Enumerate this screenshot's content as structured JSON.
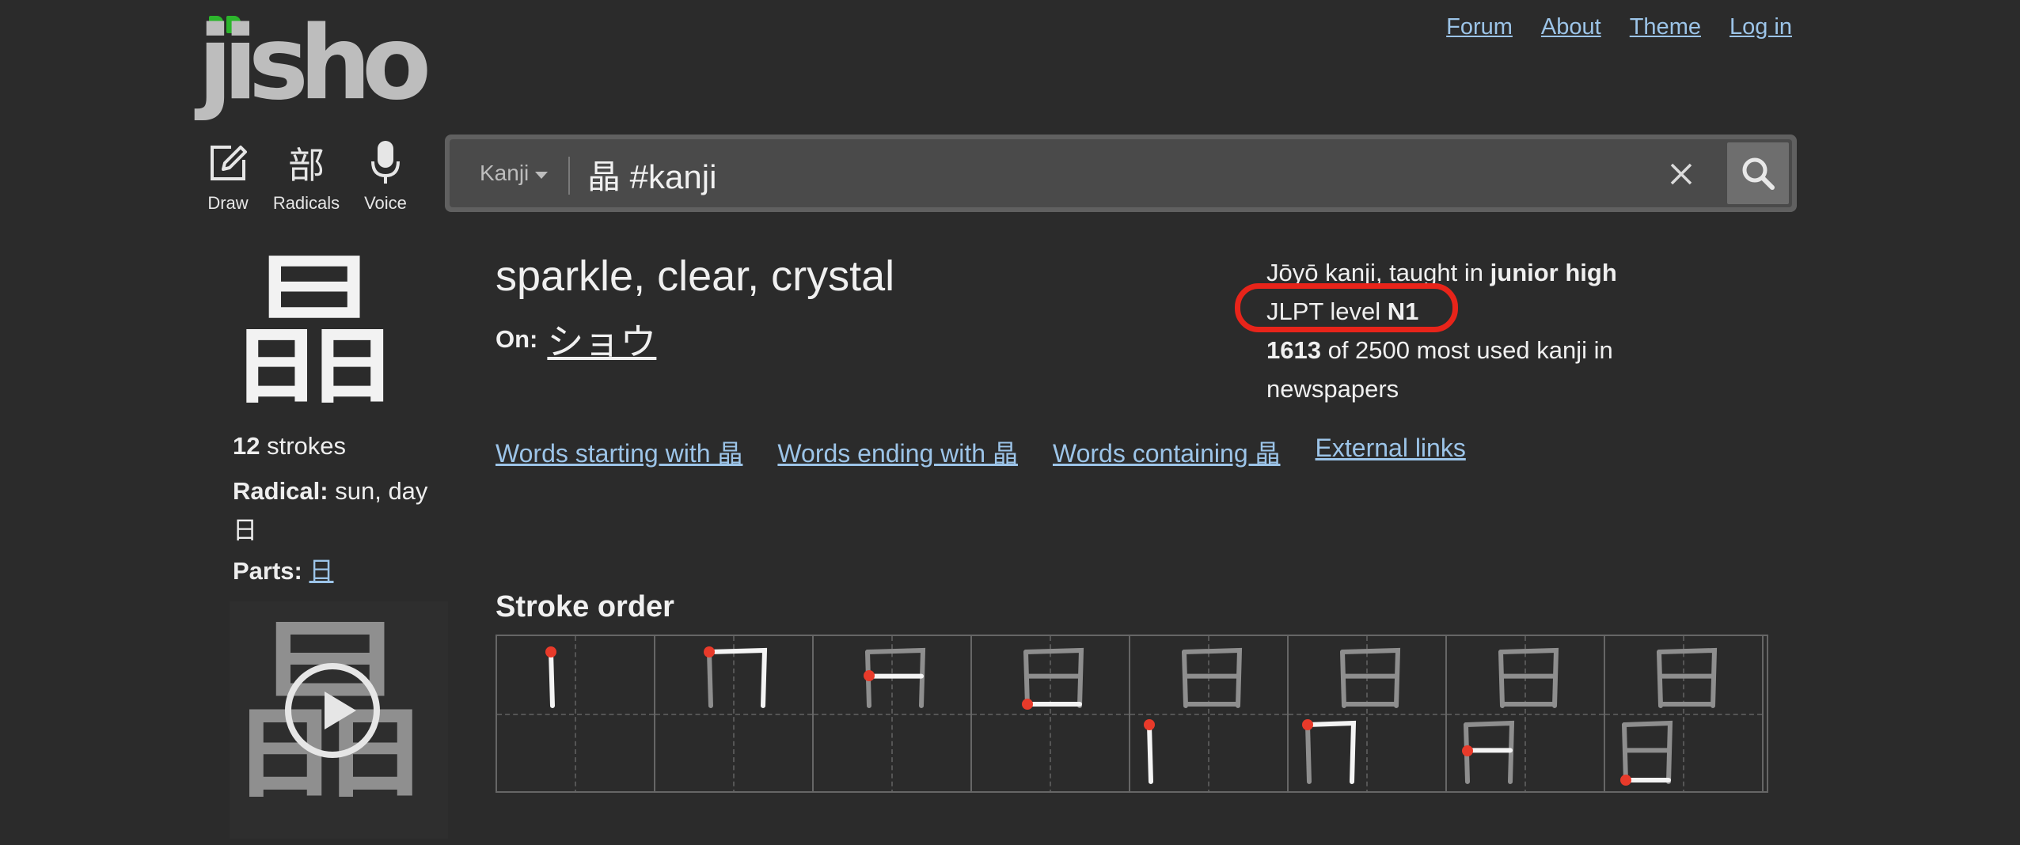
{
  "logo": {
    "text": "jisho"
  },
  "nav": {
    "links": [
      "Forum",
      "About",
      "Theme",
      "Log in"
    ]
  },
  "tools": [
    {
      "icon": "draw-icon",
      "label": "Draw"
    },
    {
      "icon": "radicals-icon",
      "glyph": "部",
      "label": "Radicals"
    },
    {
      "icon": "microphone-icon",
      "label": "Voice"
    }
  ],
  "search": {
    "type": "Kanji",
    "query": "晶 #kanji"
  },
  "kanji": {
    "character": "晶",
    "strokes": "12",
    "strokes_label": "strokes",
    "radical_label": "Radical:",
    "radical_meaning": "sun, day",
    "radical_char": "日",
    "parts_label": "Parts:",
    "parts": [
      "日"
    ],
    "meanings": "sparkle, clear, crystal",
    "on_label": "On:",
    "on_reading": "ショウ",
    "joyo_prefix": "Jōyō kanji, taught in",
    "joyo_level": "junior high",
    "jlpt_prefix": "JLPT level",
    "jlpt_level": "N1",
    "freq_rank": "1613",
    "freq_suffix": "of 2500 most used kanji in newspapers"
  },
  "word_links": [
    "Words starting with 晶",
    "Words ending with 晶",
    "Words containing 晶",
    "External links"
  ],
  "stroke_order": {
    "title": "Stroke order",
    "frames": 8
  },
  "colors": {
    "background": "#2b2b2b",
    "link": "#9cc4e8",
    "highlight": "#e8241a",
    "logo_leaf": "#2cb52c"
  }
}
